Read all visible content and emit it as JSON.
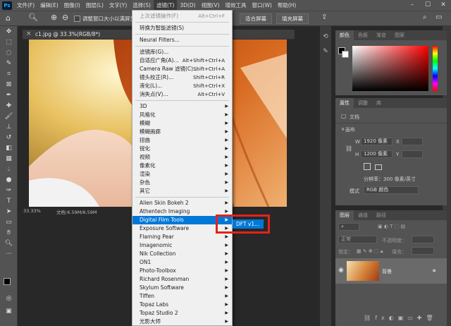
{
  "menubar": {
    "logo": "Ps",
    "items": [
      "文件(F)",
      "编辑(E)",
      "图像(I)",
      "图层(L)",
      "文字(Y)",
      "选择(S)",
      "滤镜(T)",
      "3D(D)",
      "视图(V)",
      "增效工具",
      "窗口(W)",
      "帮助(H)"
    ],
    "window_buttons": [
      "–",
      "☐",
      "✕"
    ]
  },
  "options": {
    "resize_windows": "调整窗口大小以满屏显示",
    "fit_screen": "适合屏幕",
    "fill_screen": "填充屏幕"
  },
  "document": {
    "tab_title": "c1.jpg @ 33.3%(RGB/8*)",
    "zoom": "33.33%",
    "doc_size": "文档:6.59M/6.59M"
  },
  "filter_menu": {
    "items": [
      {
        "label": "上次滤镜操作(F)",
        "shortcut": "Alt+Ctrl+F",
        "disabled": true
      },
      {
        "sep": true
      },
      {
        "label": "转换为智能滤镜(S)"
      },
      {
        "sep": true
      },
      {
        "label": "Neural Filters..."
      },
      {
        "sep": true
      },
      {
        "label": "滤镜库(G)..."
      },
      {
        "label": "自适应广角(A)...",
        "shortcut": "Alt+Shift+Ctrl+A"
      },
      {
        "label": "Camera Raw 滤镜(C)...",
        "shortcut": "Shift+Ctrl+A"
      },
      {
        "label": "镜头校正(R)...",
        "shortcut": "Shift+Ctrl+R"
      },
      {
        "label": "液化(L)...",
        "shortcut": "Shift+Ctrl+X"
      },
      {
        "label": "消失点(V)...",
        "shortcut": "Alt+Ctrl+V"
      },
      {
        "sep": true
      },
      {
        "label": "3D",
        "sub": true
      },
      {
        "label": "风格化",
        "sub": true
      },
      {
        "label": "模糊",
        "sub": true
      },
      {
        "label": "模糊画廊",
        "sub": true
      },
      {
        "label": "扭曲",
        "sub": true
      },
      {
        "label": "锐化",
        "sub": true
      },
      {
        "label": "视频",
        "sub": true
      },
      {
        "label": "像素化",
        "sub": true
      },
      {
        "label": "渲染",
        "sub": true
      },
      {
        "label": "杂色",
        "sub": true
      },
      {
        "label": "其它",
        "sub": true
      },
      {
        "sep": true
      },
      {
        "label": "Alien Skin Bokeh 2",
        "sub": true
      },
      {
        "label": "Athentech Imaging",
        "sub": true
      },
      {
        "label": "Digital Film Tools",
        "sub": true,
        "highlight": true
      },
      {
        "label": "Exposure Software",
        "sub": true
      },
      {
        "label": "Flaming Pear",
        "sub": true
      },
      {
        "label": "Imagenomic",
        "sub": true
      },
      {
        "label": "Nik Collection",
        "sub": true
      },
      {
        "label": "ON1",
        "sub": true
      },
      {
        "label": "Photo-Toolbox",
        "sub": true
      },
      {
        "label": "Richard Rosenman",
        "sub": true
      },
      {
        "label": "Skylum Software",
        "sub": true
      },
      {
        "label": "Tiffen",
        "sub": true
      },
      {
        "label": "Topaz Labs",
        "sub": true
      },
      {
        "label": "Topaz Studio 2",
        "sub": true
      },
      {
        "label": "光影大师",
        "sub": true
      }
    ],
    "submenu_item": "DFT v1..."
  },
  "color_panel": {
    "tabs": [
      "颜色",
      "色板",
      "渐变",
      "图案"
    ]
  },
  "properties_panel": {
    "tabs": [
      "属性",
      "调整",
      "库"
    ],
    "doc_label": "文档",
    "canvas_label": "画布",
    "w_label": "W",
    "w_value": "1920 像素",
    "h_label": "H",
    "h_value": "1200 像素",
    "x_label": "X",
    "y_label": "Y",
    "resolution": "分辨率：300 像素/英寸",
    "mode_label": "模式",
    "mode_value": "RGB 颜色"
  },
  "layers_panel": {
    "tabs": [
      "图层",
      "通道",
      "路径"
    ],
    "blend": "正常",
    "opacity_label": "不透明度：",
    "lock_label": "锁定：",
    "fill_label": "填充：",
    "layer_name": "背景"
  },
  "colors": {
    "highlight": "#0078d7",
    "red_box": "#e2231a",
    "panel": "#535353"
  }
}
